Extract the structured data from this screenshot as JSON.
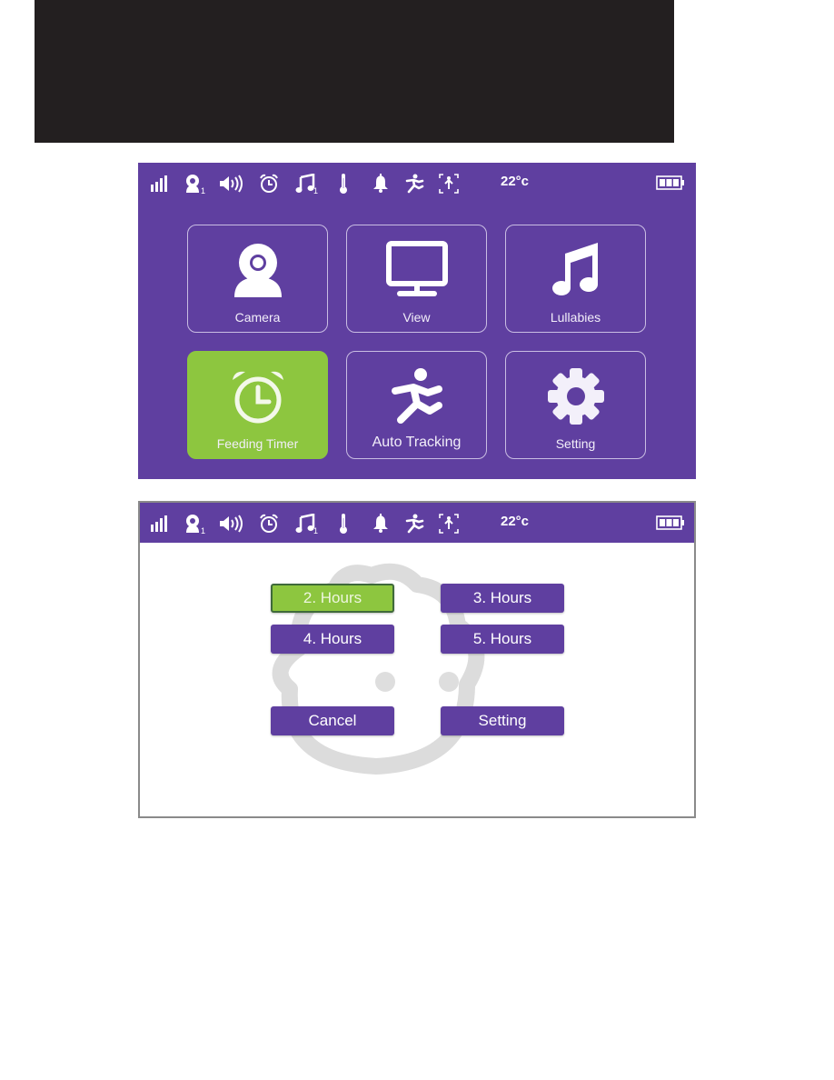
{
  "status_bar": {
    "icons": [
      "signal-icon",
      "camera-icon",
      "volume-icon",
      "alarm-icon",
      "music-icon",
      "thermometer-icon",
      "bell-icon",
      "running-icon",
      "tracking-icon",
      "battery-icon"
    ],
    "camera_number": "1",
    "lullaby_number": "1",
    "temperature": "22°c",
    "battery_level": "3/3"
  },
  "main_menu": {
    "tiles": [
      {
        "label": "Camera",
        "icon": "camera-icon"
      },
      {
        "label": "View",
        "icon": "monitor-icon"
      },
      {
        "label": "Lullabies",
        "icon": "music-note-icon"
      },
      {
        "label": "Feeding Timer",
        "icon": "alarm-clock-icon",
        "active": true
      },
      {
        "label": "Auto Tracking",
        "icon": "running-person-icon"
      },
      {
        "label": "Setting",
        "icon": "gear-icon"
      }
    ]
  },
  "feeding_timer": {
    "options": [
      "2. Hours",
      "3. Hours",
      "4. Hours",
      "5. Hours"
    ],
    "selected": "2. Hours",
    "cancel_label": "Cancel",
    "setting_label": "Setting"
  },
  "colors": {
    "primary": "#5f3fa0",
    "accent": "#8dc63f",
    "top_block": "#231f20"
  }
}
